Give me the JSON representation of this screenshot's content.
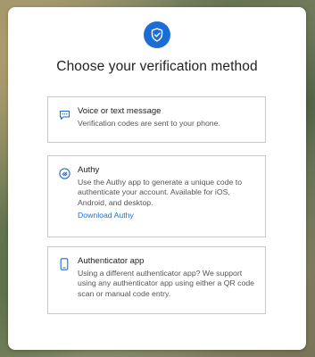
{
  "page": {
    "title": "Choose your verification method",
    "accent_color": "#1c6ed6"
  },
  "header_icon": "shield-check-icon",
  "options": [
    {
      "icon": "message-icon",
      "title": "Voice or text message",
      "description": "Verification codes are sent to your phone."
    },
    {
      "icon": "authy-icon",
      "title": "Authy",
      "description": "Use the Authy app to generate a unique code to authenticate your account. Available for iOS, Android, and desktop.",
      "link": "Download Authy"
    },
    {
      "icon": "phone-icon",
      "title": "Authenticator app",
      "description": "Using a different authenticator app? We support using any authenticator app using either a QR code scan or manual code entry."
    }
  ]
}
